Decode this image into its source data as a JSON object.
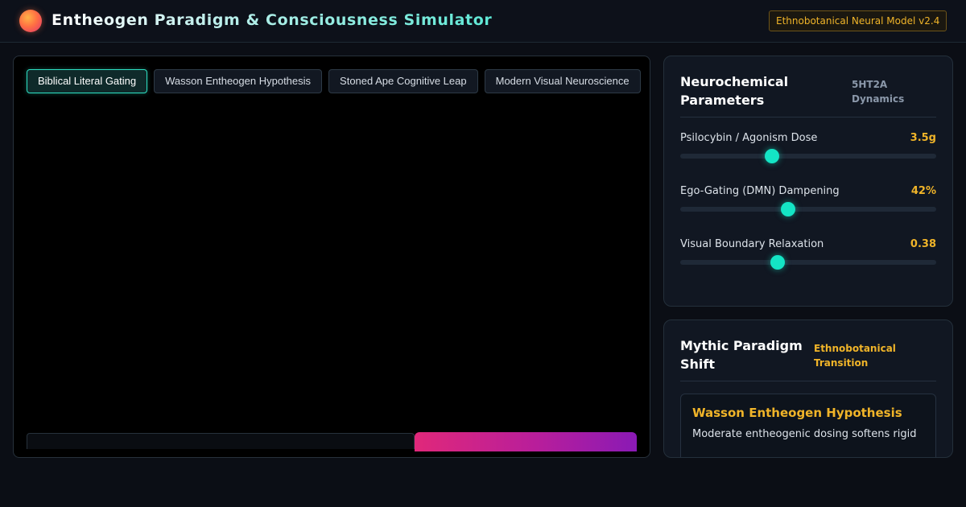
{
  "app": {
    "title": "Entheogen Paradigm & Consciousness Simulator",
    "badge": "Ethnobotanical Neural Model v2.4"
  },
  "tabs": [
    {
      "label": "Biblical Literal Gating",
      "active": true
    },
    {
      "label": "Wasson Entheogen Hypothesis",
      "active": false
    },
    {
      "label": "Stoned Ape Cognitive Leap",
      "active": false
    },
    {
      "label": "Modern Visual Neuroscience",
      "active": false
    }
  ],
  "params_card": {
    "title": "Neurochemical Parameters",
    "tag": "5HT2A Dynamics",
    "params": [
      {
        "label": "Psilocybin / Agonism Dose",
        "value": "3.5g",
        "fraction": 0.36
      },
      {
        "label": "Ego-Gating (DMN) Dampening",
        "value": "42%",
        "fraction": 0.42
      },
      {
        "label": "Visual Boundary Relaxation",
        "value": "0.38",
        "fraction": 0.38
      }
    ]
  },
  "paradigm_card": {
    "title": "Mythic Paradigm Shift",
    "tag": "Ethnobotanical Transition",
    "hypothesis_title": "Wasson Entheogen Hypothesis",
    "hypothesis_text": "Moderate entheogenic dosing softens rigid"
  },
  "colors": {
    "accent": "#14e5c5",
    "gold": "#f0b429",
    "magenta": "#e0287a",
    "violet": "#8a1ab5"
  }
}
